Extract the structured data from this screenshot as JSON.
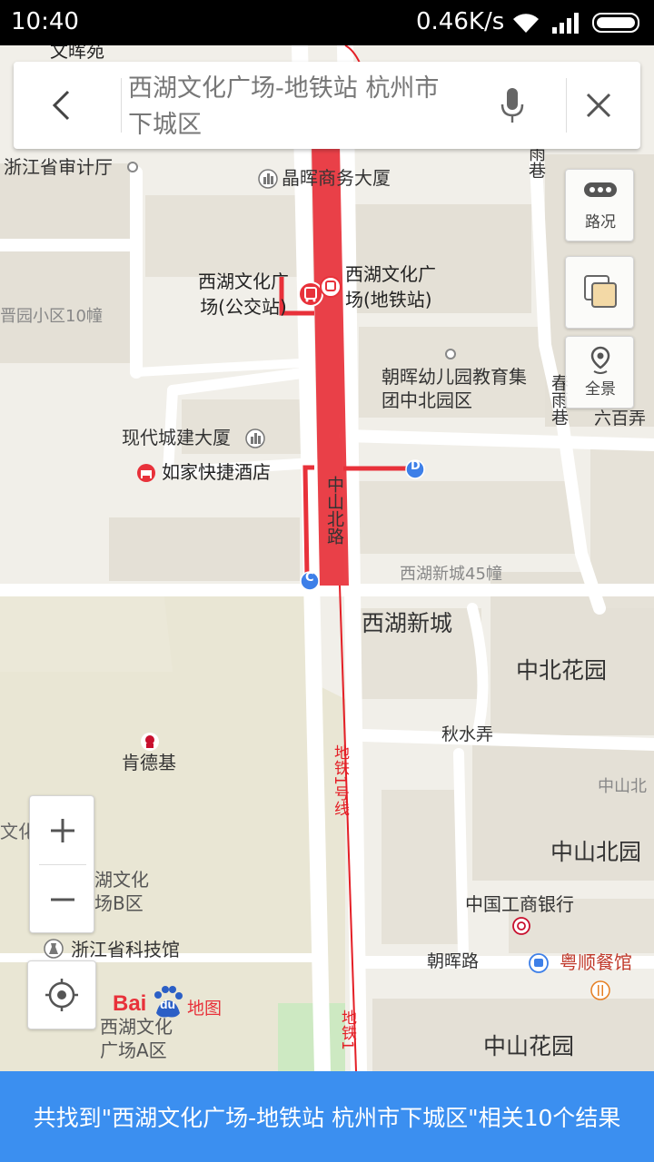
{
  "status_bar": {
    "time": "10:40",
    "speed": "0.46K/s",
    "icons": [
      "wifi-icon",
      "signal-icon",
      "battery-icon"
    ]
  },
  "search": {
    "query": "西湖文化广场-地铁站 杭州市下城区",
    "icons": [
      "back-arrow-icon",
      "microphone-icon",
      "close-icon"
    ]
  },
  "controls": {
    "traffic_label": "路况",
    "layers_icon": "layers-icon",
    "panorama_label": "全景"
  },
  "map": {
    "labels": {
      "wenhuiyuan": "文晖苑",
      "audit_office": "浙江省审计厅",
      "jinghui_building": "晶晖商务大厦",
      "bus_station": "西湖文化广场(公交站)",
      "metro_station": "西湖文化广场(地铁站)",
      "community": "晋园小区10幢",
      "kindergarten": "朝晖幼儿园教育集团中北园区",
      "chunyu_alley_top": "春雨巷",
      "chunyu_alley": "春雨巷",
      "liubai_lane": "六百弄",
      "xiandai_building": "现代城建大厦",
      "rujia_hotel": "如家快捷酒店",
      "zhongshan_north_road": "中山北路",
      "xihu_new_city_45": "西湖新城45幢",
      "xihu_new_city": "西湖新城",
      "zhongbei_garden": "中北花园",
      "qiushui_lane": "秋水弄",
      "kfc": "肯德基",
      "metro_line1": "地铁1号线",
      "metro_line1_lower": "地铁1",
      "zhongshan_north_short": "中山北",
      "zhongshan_north_garden": "中山北园",
      "wen": "文化",
      "plaza_b": "西湖文化广场B区",
      "icbc": "中国工商银行",
      "science_museum": "浙江省科技馆",
      "zhaohui_road": "朝晖路",
      "yueshun_restaurant": "粤顺餐馆",
      "plaza_a": "西湖文化广场A区",
      "zhongshan_garden": "中山花园"
    },
    "markers": [
      "D",
      "C"
    ],
    "colors": {
      "route": "#e8313a",
      "marker": "#3d7fe8",
      "land": "#f1efe9",
      "block": "#e4e0d6",
      "park": "#e9e6d4",
      "green": "#cde9c2",
      "road": "#ffffff"
    }
  },
  "logo": {
    "brand_text": "Bai",
    "brand_paw": "du",
    "brand_map": "地图"
  },
  "result": {
    "text": "共找到\"西湖文化广场-地铁站 杭州市下城区\"相关10个结果"
  }
}
